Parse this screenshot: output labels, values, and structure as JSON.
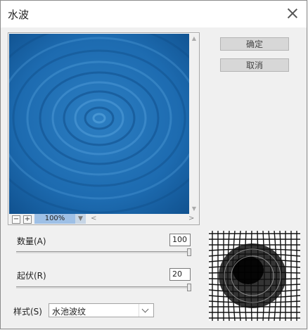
{
  "window": {
    "title": "水波"
  },
  "buttons": {
    "ok": "确定",
    "cancel": "取消"
  },
  "preview": {
    "zoom": "100%",
    "zoom_out": "−",
    "zoom_in": "+"
  },
  "params": {
    "amount": {
      "label": "数量(A)",
      "value": "100",
      "fraction": 1.0
    },
    "ridges": {
      "label": "起伏(R)",
      "value": "20",
      "fraction": 1.0
    }
  },
  "style": {
    "label": "样式(S)",
    "value": "水池波纹"
  },
  "colors": {
    "water_dark": "#10508c",
    "water_light": "#3a8cd0",
    "zoom_highlight": "#9ec0e6"
  }
}
